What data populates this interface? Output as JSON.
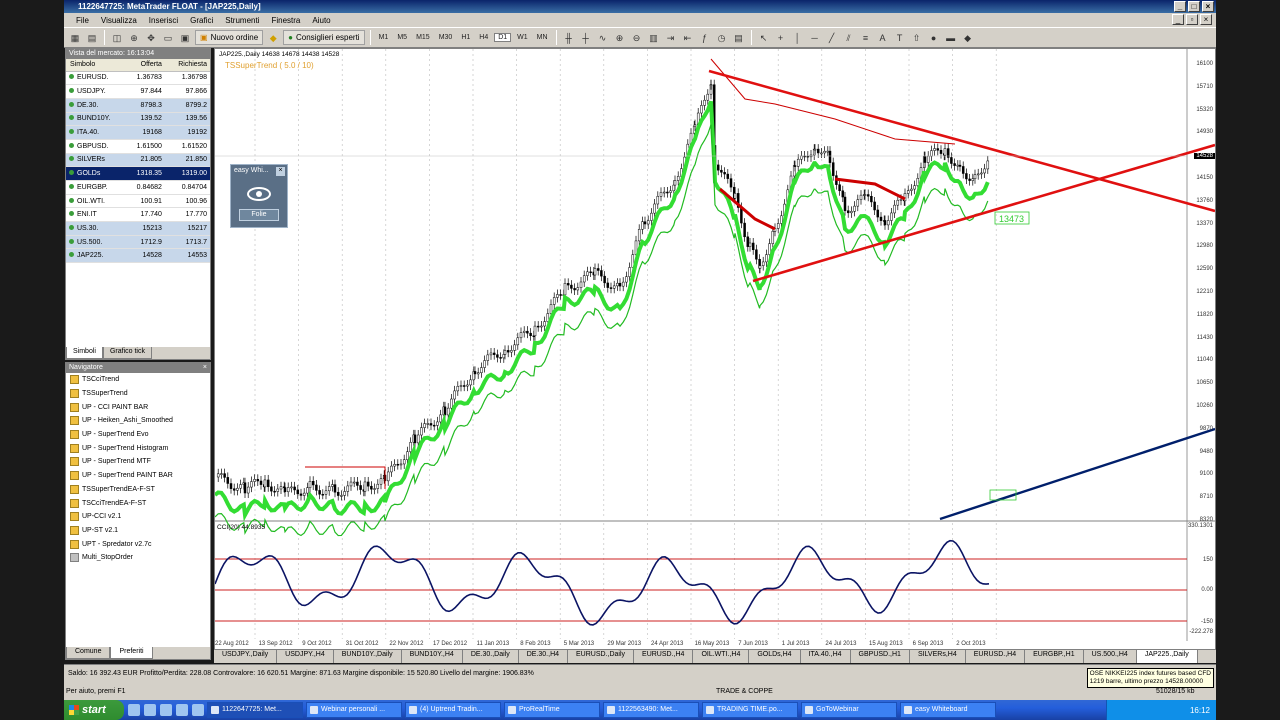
{
  "window": {
    "title": "1122647725: MetaTrader FLOAT - [JAP225,Daily]"
  },
  "menu": [
    "File",
    "Visualizza",
    "Inserisci",
    "Grafici",
    "Strumenti",
    "Finestra",
    "Aiuto"
  ],
  "toolbar": {
    "new_order": "Nuovo ordine",
    "expert_advisors": "Consiglieri esperti",
    "timeframes": [
      "M1",
      "M5",
      "M15",
      "M30",
      "H1",
      "H4",
      "D1",
      "W1",
      "MN"
    ],
    "active_timeframe": "D1"
  },
  "market_watch": {
    "header": "Vista del mercato: 16:13:04",
    "columns": [
      "Simbolo",
      "Offerta",
      "Richiesta"
    ],
    "rows": [
      {
        "symbol": "EURUSD.",
        "bid": "1.36783",
        "ask": "1.36798"
      },
      {
        "symbol": "USDJPY.",
        "bid": "97.844",
        "ask": "97.866"
      },
      {
        "symbol": "DE.30.",
        "bid": "8798.3",
        "ask": "8799.2"
      },
      {
        "symbol": "BUND10Y.",
        "bid": "139.52",
        "ask": "139.56"
      },
      {
        "symbol": "ITA.40.",
        "bid": "19168",
        "ask": "19192"
      },
      {
        "symbol": "GBPUSD.",
        "bid": "1.61500",
        "ask": "1.61520"
      },
      {
        "symbol": "SILVERs",
        "bid": "21.805",
        "ask": "21.850"
      },
      {
        "symbol": "GOLDs",
        "bid": "1318.35",
        "ask": "1319.00"
      },
      {
        "symbol": "EURGBP.",
        "bid": "0.84682",
        "ask": "0.84704"
      },
      {
        "symbol": "OIL.WTI.",
        "bid": "100.91",
        "ask": "100.96"
      },
      {
        "symbol": "ENI.IT",
        "bid": "17.740",
        "ask": "17.770"
      },
      {
        "symbol": "US.30.",
        "bid": "15213",
        "ask": "15217"
      },
      {
        "symbol": "US.500.",
        "bid": "1712.9",
        "ask": "1713.7"
      },
      {
        "symbol": "JAP225.",
        "bid": "14528",
        "ask": "14553"
      }
    ],
    "tabs": [
      "Simboli",
      "Grafico tick"
    ]
  },
  "navigator": {
    "header": "Navigatore",
    "items": [
      "TSCciTrend",
      "TSSuperTrend",
      "UP - CCI PAINT BAR",
      "UP - Heiken_Ashi_Smoothed",
      "UP - SuperTrend Evo",
      "UP - SuperTrend Histogram",
      "UP - SuperTrend MTF",
      "UP - SuperTrend PAINT BAR",
      "TSSuperTrendEA-F-ST",
      "TSCciTrendEA-F-ST",
      "UP-CCI v2.1",
      "UP-ST v2.1",
      "UPT - Spredator v2.7c",
      "Multi_StopOrder"
    ],
    "tabs": [
      "Comune",
      "Preferiti"
    ]
  },
  "chart": {
    "title": "JAP225.,Daily  14638 14678 14438 14528",
    "indicator_label": "TSSuperTrend ( 5.0 / 10)",
    "cci_label": "CCI(20) 44.8935",
    "price_labels": [
      "16100",
      "15710",
      "15320",
      "14930",
      "14528",
      "14150",
      "13760",
      "13370",
      "12980",
      "12590",
      "12210",
      "11820",
      "11430",
      "11040",
      "10650",
      "10260",
      "9870",
      "9480",
      "9100",
      "8710",
      "8320"
    ],
    "current_price": "14528",
    "cci_levels": [
      "330.1301",
      "150",
      "0.00",
      "-150",
      "-222.278"
    ],
    "date_labels": [
      "22 Aug 2012",
      "13 Sep 2012",
      "9 Oct 2012",
      "31 Oct 2012",
      "22 Nov 2012",
      "17 Dec 2012",
      "11 Jan 2013",
      "8 Feb 2013",
      "5 Mar 2013",
      "29 Mar 2013",
      "24 Apr 2013",
      "16 May 2013",
      "7 Jun 2013",
      "1 Jul 2013",
      "24 Jul 2013",
      "15 Aug 2013",
      "6 Sep 2013",
      "2 Oct 2013"
    ],
    "annotation_1": "13473"
  },
  "easy_whiteboard": {
    "title": "easy Whi...",
    "button": "Folie"
  },
  "chart_tabs": [
    "USDJPY.,Daily",
    "USDJPY.,H4",
    "BUND10Y.,Daily",
    "BUND10Y.,H4",
    "DE.30.,Daily",
    "DE.30.,H4",
    "EURUSD.,Daily",
    "EURUSD.,H4",
    "OIL.WTI.,H4",
    "GOLDs,H4",
    "ITA.40.,H4",
    "GBPUSD.,H1",
    "SILVERs,H4",
    "EURUSD.,H4",
    "EURGBP.,H1",
    "US.500.,H4",
    "JAP225.,Daily"
  ],
  "status": {
    "account": "Saldo: 16 392.43 EUR  Profitto/Perdita: 228.08  Controvalore: 16 620.51  Margine: 871.63  Margine disponibile: 15 520.80  Livello del margine: 1906.83%",
    "help": "Per aiuto, premi F1",
    "mode": "TRADE & COPPE",
    "traffic": "51028/15 kb"
  },
  "tooltip": {
    "line1": "OSE NIKKEI225 index futures based CFD",
    "line2": "1219 barre, ultimo prezzo 14528.00000"
  },
  "taskbar": {
    "start": "start",
    "tasks": [
      "1122647725: Met...",
      "Webinar personali ...",
      "(4) Uptrend Tradin...",
      "ProRealTime",
      "1122563490: Met...",
      "TRADING TIME.po...",
      "GoToWebinar",
      "easy Whiteboard"
    ],
    "clock": "16:12"
  },
  "colors": {
    "bull": "#00cc00",
    "bear": "#cc0000",
    "trendline": "#e01010",
    "navy_line": "#001f6b"
  }
}
